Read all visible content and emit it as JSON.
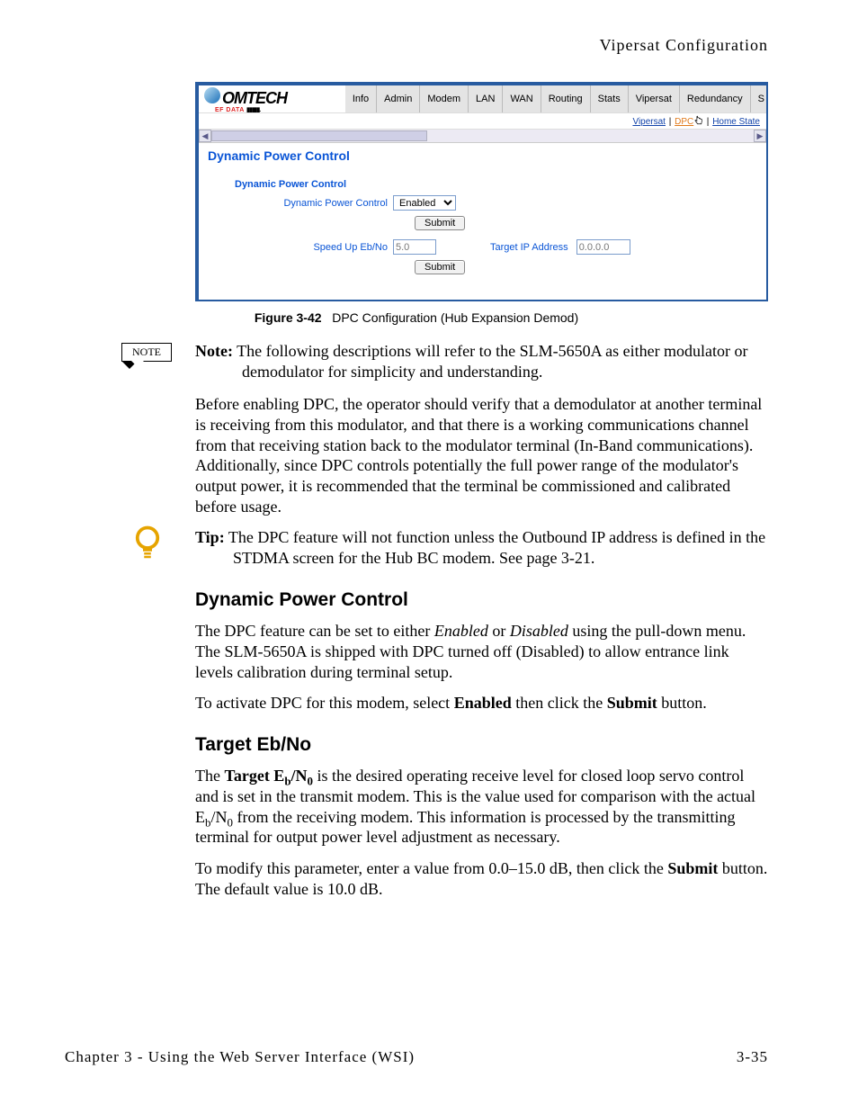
{
  "running_head": "Vipersat Configuration",
  "shot": {
    "logo_main": "OMTECH",
    "logo_sub_red": "EF DATA",
    "nav": [
      "Info",
      "Admin",
      "Modem",
      "LAN",
      "WAN",
      "Routing",
      "Stats",
      "Vipersat",
      "Redundancy",
      "S"
    ],
    "subnav": {
      "left": "Vipersat",
      "mid": "DPC",
      "right": "Home State"
    },
    "panel_title": "Dynamic Power Control",
    "box_title": "Dynamic Power Control",
    "dpc_label": "Dynamic Power Control",
    "dpc_value": "Enabled",
    "submit": "Submit",
    "speed_label": "Speed Up Eb/No",
    "speed_value": "5.0",
    "target_label": "Target IP Address",
    "target_value": "0.0.0.0"
  },
  "fig": {
    "num": "Figure 3-42",
    "caption": "DPC Configuration (Hub Expansion Demod)"
  },
  "note": {
    "icon": "NOTE",
    "lead": "Note:",
    "text": "  The following descriptions will refer to the SLM-5650A as either modulator or demodulator for simplicity and understanding."
  },
  "para_before": "Before enabling DPC, the operator should verify that a demodulator at another terminal is receiving from this modulator, and that there is a working communications channel from that receiving station back to the modulator terminal (In-Band communications). Additionally, since DPC controls potentially the full power range of the modulator's output power, it is recommended that the terminal be commissioned and calibrated before usage.",
  "tip": {
    "lead": "Tip:",
    "text": "  The DPC feature will not function unless the Outbound IP address is defined in the STDMA screen for the Hub BC modem. See page 3-21."
  },
  "sec_dpc": {
    "heading": "Dynamic Power Control",
    "p1a": "The  DPC feature can be set to either ",
    "p1b": "Enabled",
    "p1c": " or ",
    "p1d": "Disabled",
    "p1e": " using the pull-down menu. The SLM-5650A is shipped with DPC turned off (Disabled) to allow entrance link levels calibration during terminal setup.",
    "p2a": "To activate DPC for this modem, select ",
    "p2b": "Enabled",
    "p2c": " then click the ",
    "p2d": "Submit",
    "p2e": " button."
  },
  "sec_target": {
    "heading": "Target Eb/No",
    "p1a": "The ",
    "p1b": "Target E",
    "p1c": "/N",
    "p1d": " is the desired operating receive level for closed loop servo control and is set in the transmit modem. This is the value used for comparison with the actual E",
    "p1e": "/N",
    "p1f": " from the receiving modem. This information is processed by the transmitting terminal for output power level adjustment as necessary.",
    "p2a": "To modify this parameter, enter a value from 0.0–15.0 dB, then click the ",
    "p2b": "Submit",
    "p2c": " button. The default value is 10.0 dB."
  },
  "footer": {
    "left": "Chapter 3 - Using the Web Server Interface (WSI)",
    "right": "3-35"
  }
}
